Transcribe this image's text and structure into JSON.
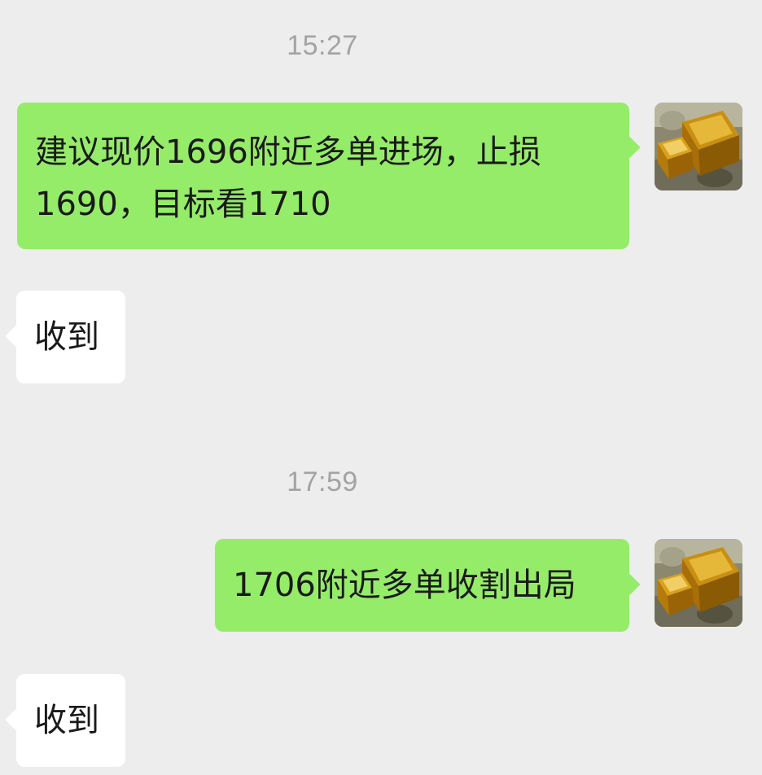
{
  "chat": {
    "messages": [
      {
        "timestamp": "15:27"
      },
      {
        "direction": "outgoing",
        "text": "建议现价1696附近多单进场，止损\n1690，目标看1710",
        "avatar_icon": "gold-bar-avatar-icon"
      },
      {
        "direction": "incoming",
        "text": "收到"
      },
      {
        "timestamp": "17:59"
      },
      {
        "direction": "outgoing",
        "text": "1706附近多单收割出局",
        "avatar_icon": "gold-bar-avatar-icon"
      },
      {
        "direction": "incoming",
        "text": "收到"
      }
    ]
  },
  "colors": {
    "background": "#ededed",
    "outgoing_bubble": "#95ec69",
    "incoming_bubble": "#ffffff",
    "timestamp_text": "#a3a3a3",
    "message_text": "#1a1a1a"
  }
}
